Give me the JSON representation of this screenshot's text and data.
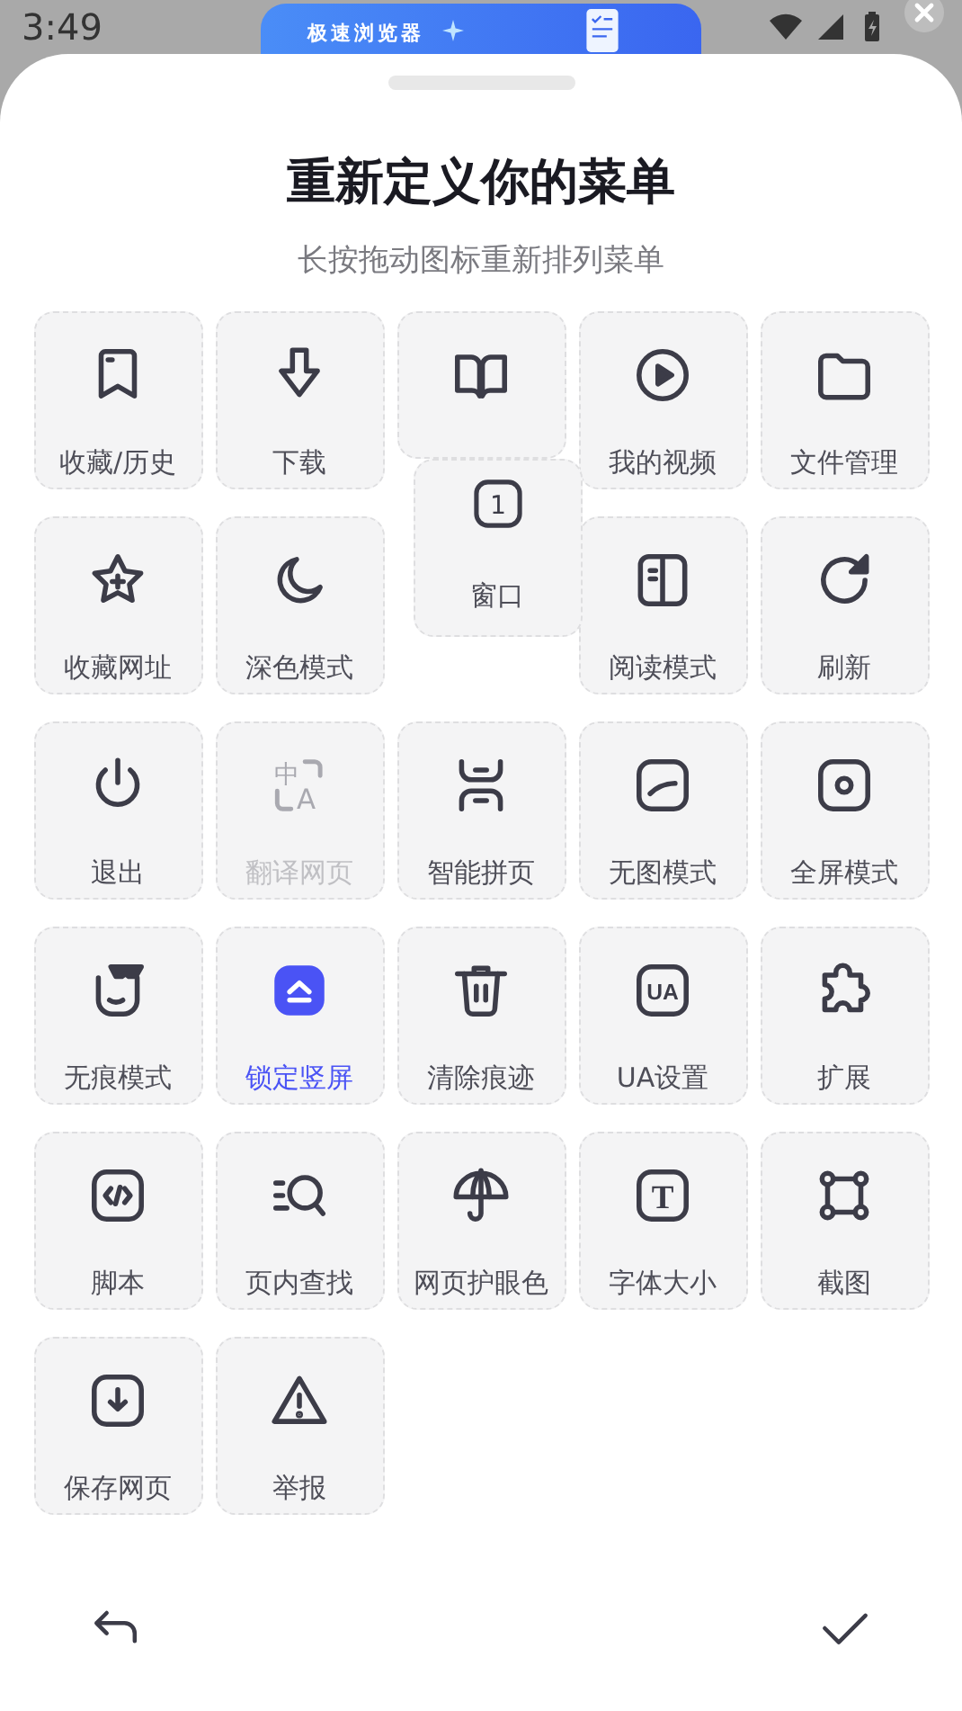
{
  "status_bar": {
    "time": "3:49"
  },
  "banner": {
    "title": "极速浏览器"
  },
  "sheet": {
    "title": "重新定义你的菜单",
    "subtitle": "长按拖动图标重新排列菜单"
  },
  "items": [
    {
      "kind": "tile",
      "label": "收藏/历史",
      "on": false,
      "disabled": false
    },
    {
      "kind": "tile",
      "label": "下载",
      "on": false,
      "disabled": false
    },
    {
      "kind": "tile",
      "on": false,
      "disabled": false
    },
    {
      "kind": "tile",
      "label": "我的视频",
      "on": false,
      "disabled": false
    },
    {
      "kind": "tile",
      "label": "文件管理",
      "on": false,
      "disabled": false
    },
    {
      "kind": "tile",
      "label": "收藏网址",
      "on": false,
      "disabled": false
    },
    {
      "kind": "tile",
      "label": "深色模式",
      "on": false,
      "disabled": false
    },
    {
      "kind": "empty"
    },
    {
      "kind": "tile",
      "label": "阅读模式",
      "on": false,
      "disabled": false
    },
    {
      "kind": "tile",
      "label": "刷新",
      "on": false,
      "disabled": false
    },
    {
      "kind": "tile",
      "label": "退出",
      "on": false,
      "disabled": false
    },
    {
      "kind": "tile",
      "label": "翻译网页",
      "on": false,
      "disabled": true,
      "icon_text": "中A"
    },
    {
      "kind": "tile",
      "label": "智能拼页",
      "on": false,
      "disabled": false
    },
    {
      "kind": "tile",
      "label": "无图模式",
      "on": false,
      "disabled": false
    },
    {
      "kind": "tile",
      "label": "全屏模式",
      "on": false,
      "disabled": false
    },
    {
      "kind": "tile",
      "label": "无痕模式",
      "on": false,
      "disabled": false
    },
    {
      "kind": "tile",
      "label": "锁定竖屏",
      "on": true,
      "disabled": false
    },
    {
      "kind": "tile",
      "label": "清除痕迹",
      "on": false,
      "disabled": false
    },
    {
      "kind": "tile",
      "label": "UA设置",
      "on": false,
      "disabled": false,
      "icon_text": "UA"
    },
    {
      "kind": "tile",
      "label": "扩展",
      "on": false,
      "disabled": false
    },
    {
      "kind": "tile",
      "label": "脚本",
      "on": false,
      "disabled": false
    },
    {
      "kind": "tile",
      "label": "页内查找",
      "on": false,
      "disabled": false
    },
    {
      "kind": "tile",
      "label": "网页护眼色",
      "on": false,
      "disabled": false
    },
    {
      "kind": "tile",
      "label": "字体大小",
      "on": false,
      "disabled": false,
      "icon_text": "T"
    },
    {
      "kind": "tile",
      "label": "截图",
      "on": false,
      "disabled": false
    },
    {
      "kind": "tile",
      "label": "保存网页",
      "on": false,
      "disabled": false
    },
    {
      "kind": "tile",
      "label": "举报",
      "on": false,
      "disabled": false
    }
  ],
  "dragging_item": {
    "label": "窗口",
    "icon_text": "1"
  }
}
